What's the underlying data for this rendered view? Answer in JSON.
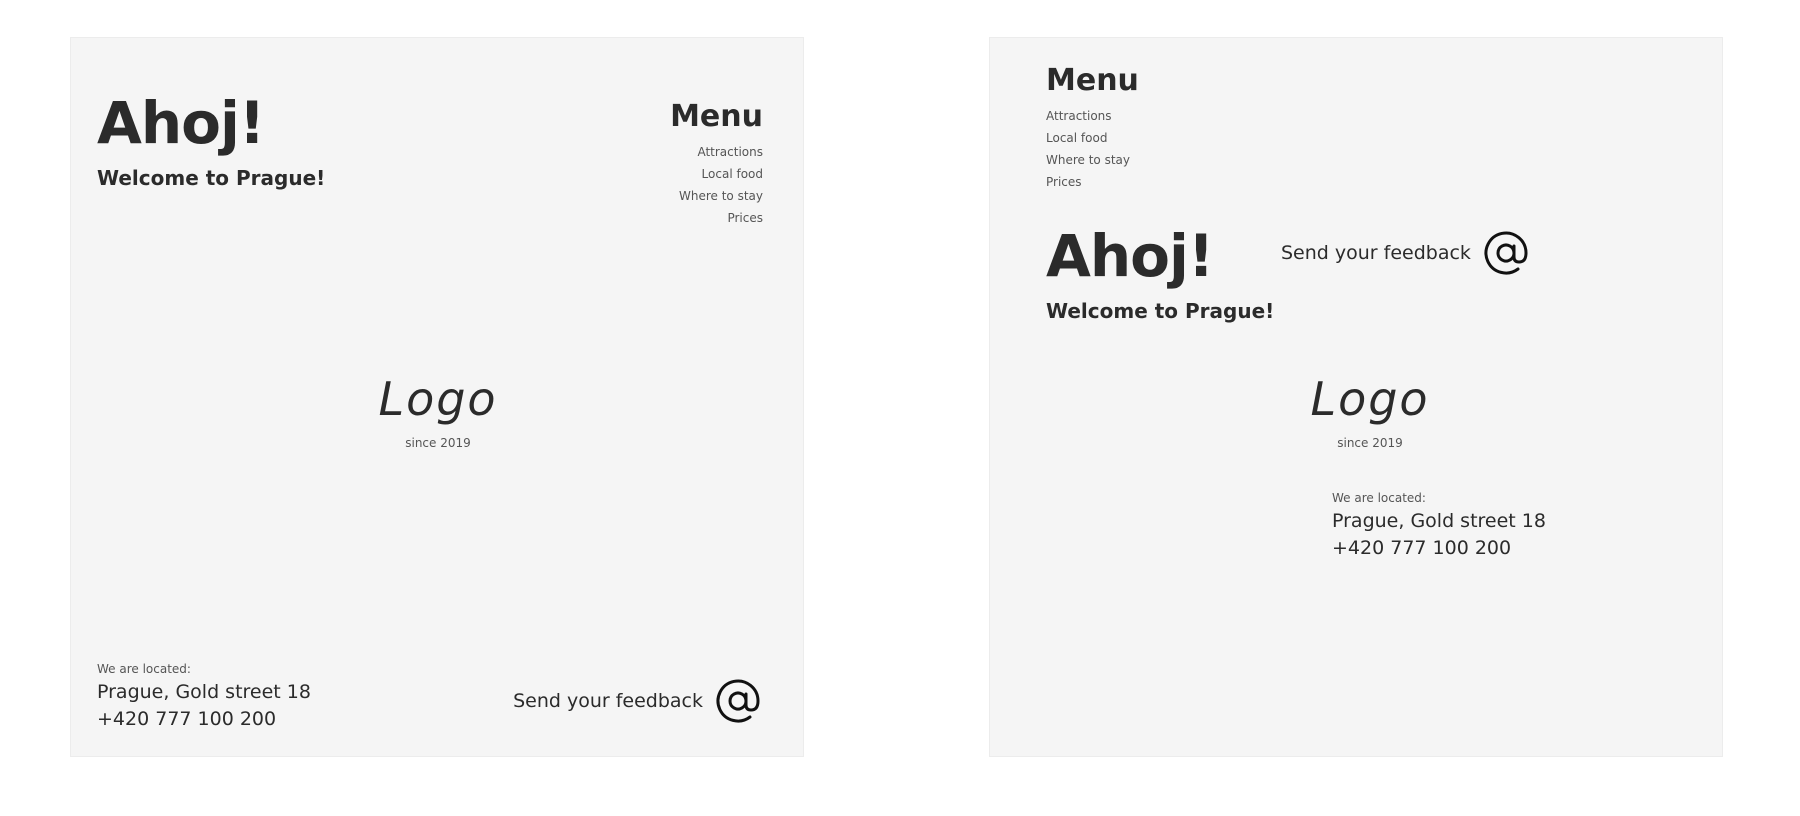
{
  "layouts": [
    {
      "greeting": "Ahoj!",
      "welcome": "Welcome to Prague!",
      "menu": {
        "title": "Menu",
        "items": [
          "Attractions",
          "Local food",
          "Where to stay",
          "Prices"
        ]
      },
      "logo": {
        "text": "Logo",
        "since": "since 2019"
      },
      "location": {
        "label": "We are located:",
        "address": "Prague, Gold street 18",
        "phone": "+420 777 100 200"
      },
      "feedback": {
        "label": "Send your feedback",
        "icon": "at-icon"
      }
    },
    {
      "greeting": "Ahoj!",
      "welcome": "Welcome to Prague!",
      "menu": {
        "title": "Menu",
        "items": [
          "Attractions",
          "Local food",
          "Where to stay",
          "Prices"
        ]
      },
      "logo": {
        "text": "Logo",
        "since": "since 2019"
      },
      "location": {
        "label": "We are located:",
        "address": "Prague, Gold street 18",
        "phone": "+420 777 100 200"
      },
      "feedback": {
        "label": "Send your feedback",
        "icon": "at-icon"
      }
    }
  ],
  "colors": {
    "card_background": "#f5f5f5",
    "text_primary": "#2b2b2b",
    "text_secondary": "#555555"
  }
}
